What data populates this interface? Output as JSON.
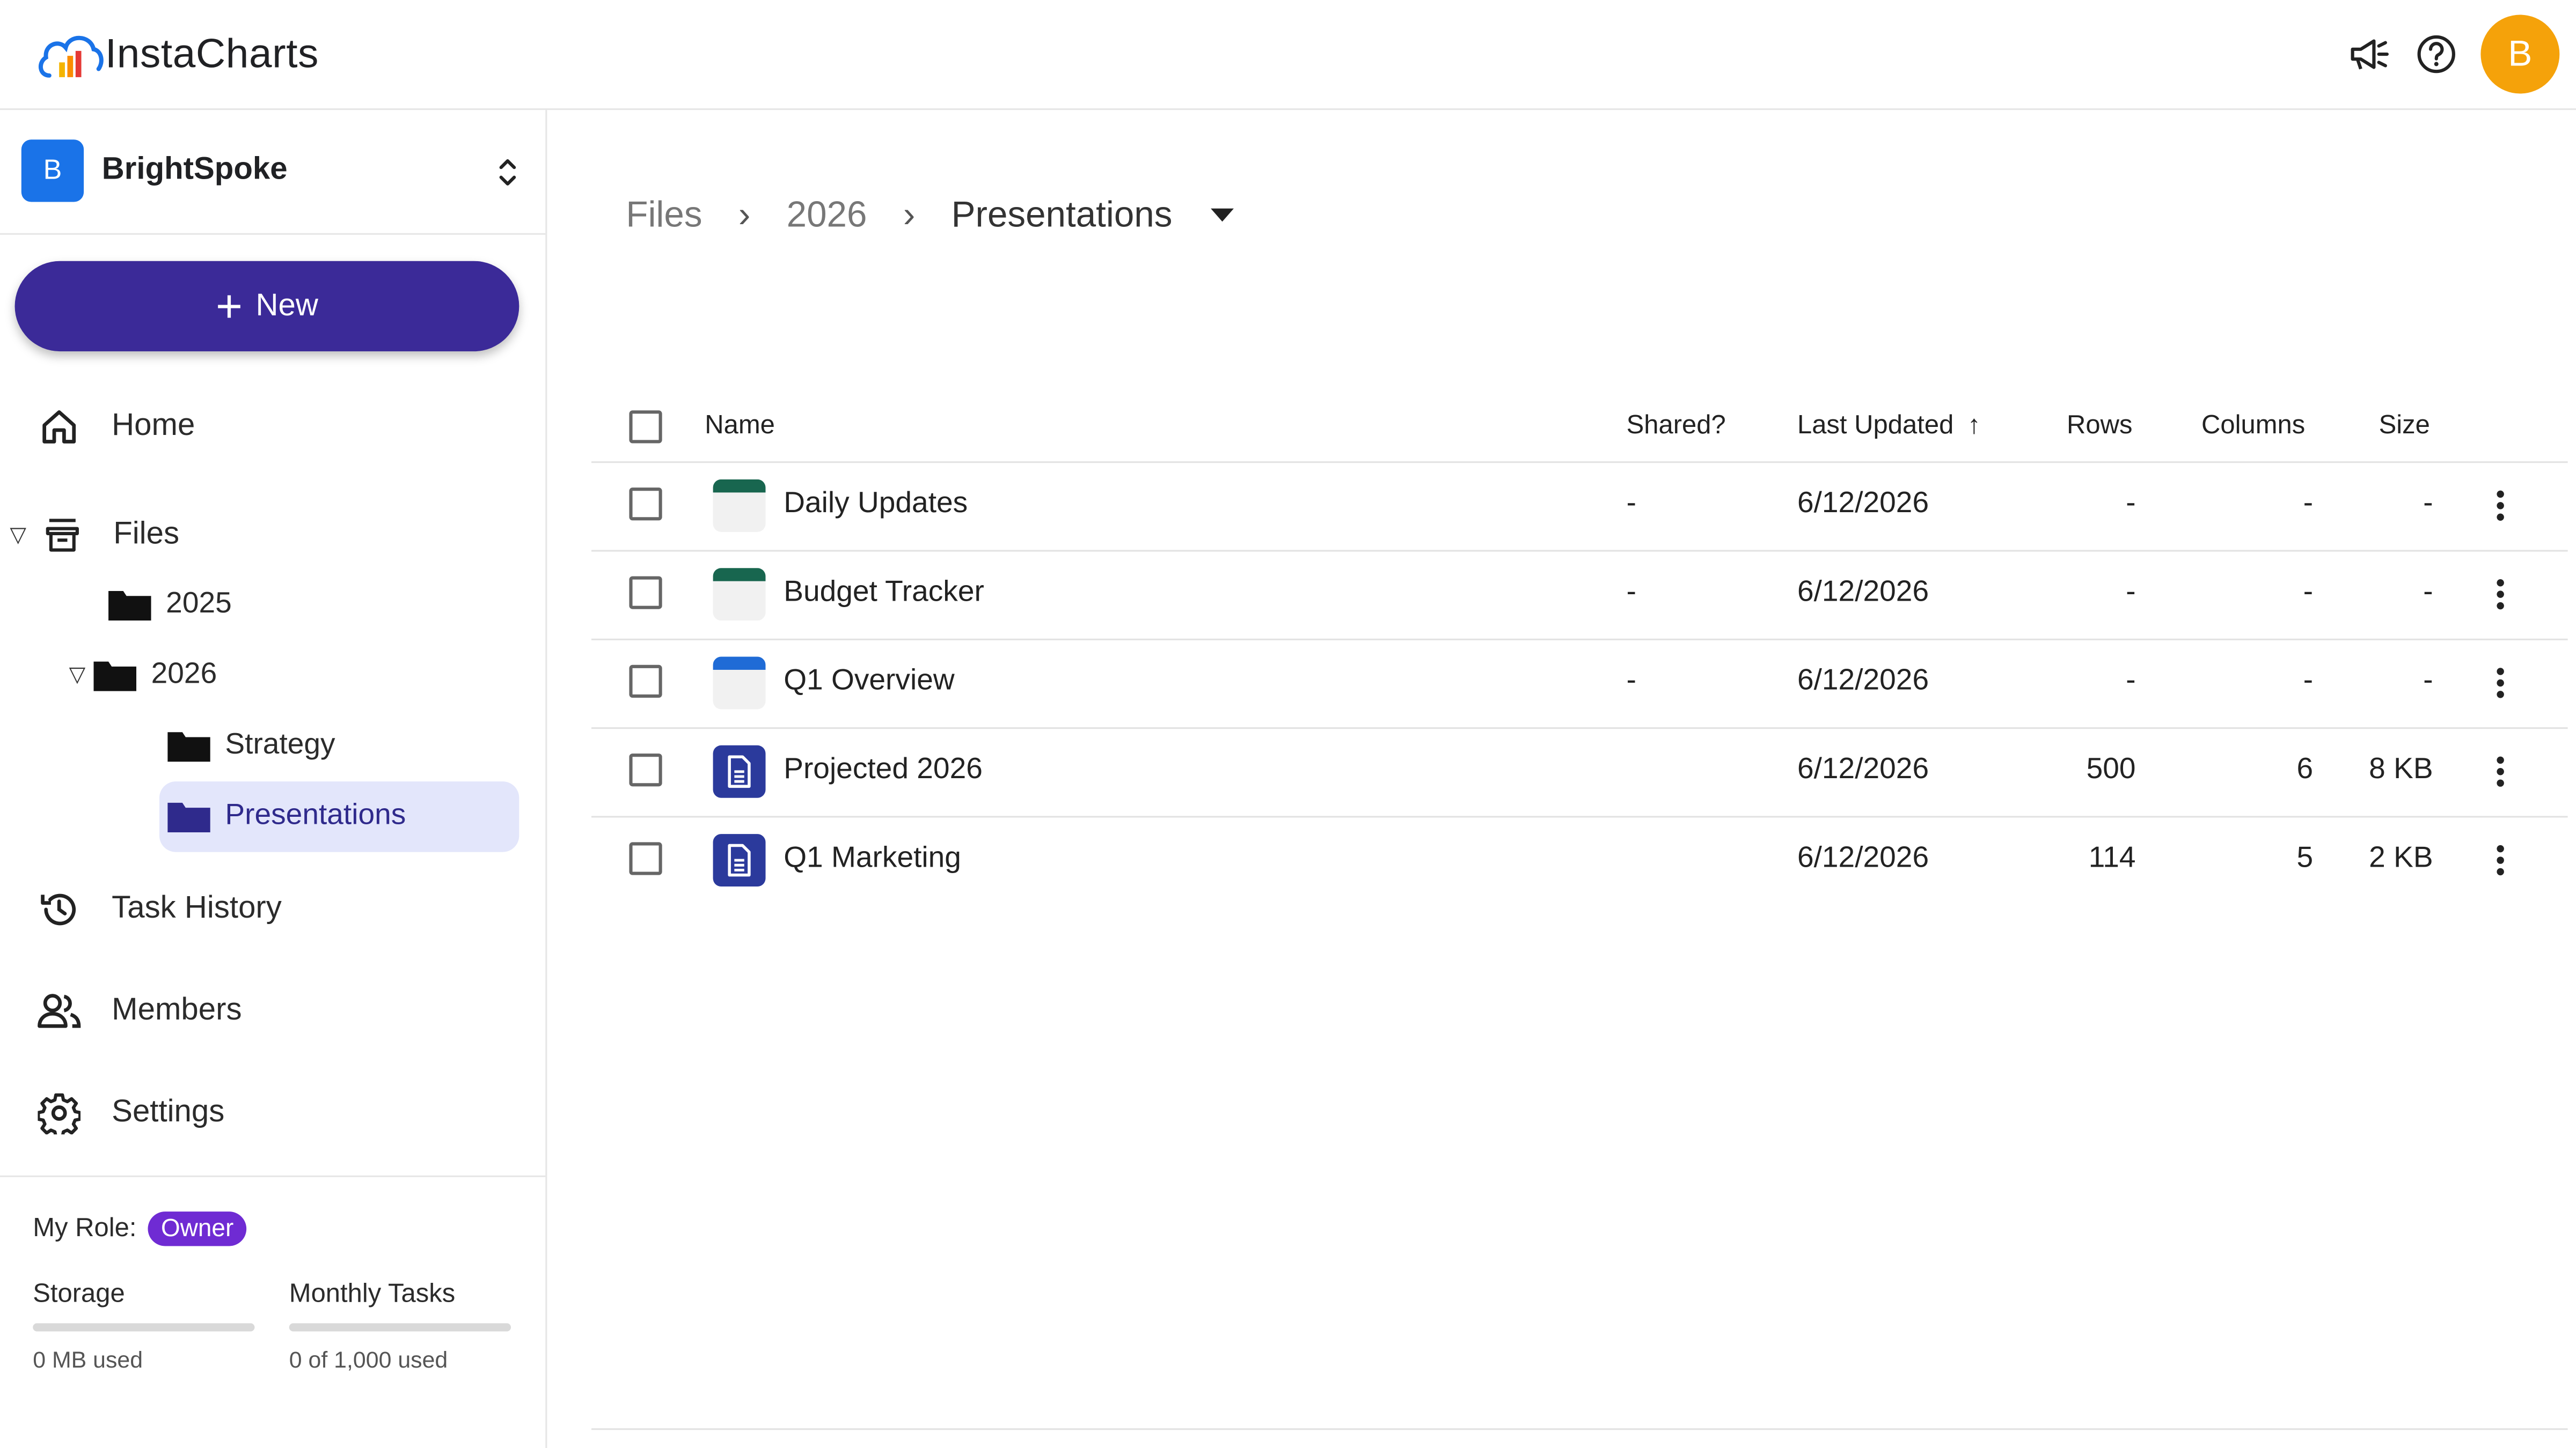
{
  "app": {
    "name": "InstaCharts",
    "avatar_initial": "B"
  },
  "colors": {
    "primary": "#3b2a98",
    "avatar": "#f5a20a",
    "org_badge": "#1a73e8",
    "role_chip": "#6f2bd3",
    "selected_bg": "#e3e6fb",
    "sheet_green": "#18664f",
    "sheet_blue": "#1f6bd6",
    "doc_blue": "#2b3a9c"
  },
  "org": {
    "initial": "B",
    "name": "BrightSpoke"
  },
  "sidebar": {
    "new_label": "New",
    "home": "Home",
    "files": "Files",
    "folders": {
      "f2025": "2025",
      "f2026": "2026",
      "strategy": "Strategy",
      "presentations": "Presentations"
    },
    "task_history": "Task History",
    "members": "Members",
    "settings": "Settings",
    "role_label": "My Role:",
    "role_value": "Owner",
    "storage_title": "Storage",
    "storage_used": "0 MB used",
    "storage_fraction": 0,
    "tasks_title": "Monthly Tasks",
    "tasks_used": "0 of 1,000 used",
    "tasks_fraction": 0
  },
  "breadcrumb": {
    "items": [
      "Files",
      "2026",
      "Presentations"
    ],
    "separator": "›"
  },
  "table": {
    "headers": {
      "name": "Name",
      "shared": "Shared?",
      "updated": "Last Updated",
      "rows": "Rows",
      "columns": "Columns",
      "size": "Size"
    },
    "sort_indicator": "↑",
    "rows": [
      {
        "name": "Daily Updates",
        "shared": "-",
        "updated": "6/12/2026",
        "rows": "-",
        "columns": "-",
        "size": "-",
        "icon": "sheet-green-icon"
      },
      {
        "name": "Budget Tracker",
        "shared": "-",
        "updated": "6/12/2026",
        "rows": "-",
        "columns": "-",
        "size": "-",
        "icon": "sheet-green-icon"
      },
      {
        "name": "Q1 Overview",
        "shared": "-",
        "updated": "6/12/2026",
        "rows": "-",
        "columns": "-",
        "size": "-",
        "icon": "sheet-blue-icon"
      },
      {
        "name": "Projected 2026",
        "shared": "",
        "updated": "6/12/2026",
        "rows": "500",
        "columns": "6",
        "size": "8 KB",
        "icon": "document-icon"
      },
      {
        "name": "Q1 Marketing",
        "shared": "",
        "updated": "6/12/2026",
        "rows": "114",
        "columns": "5",
        "size": "2 KB",
        "icon": "document-icon"
      }
    ]
  }
}
